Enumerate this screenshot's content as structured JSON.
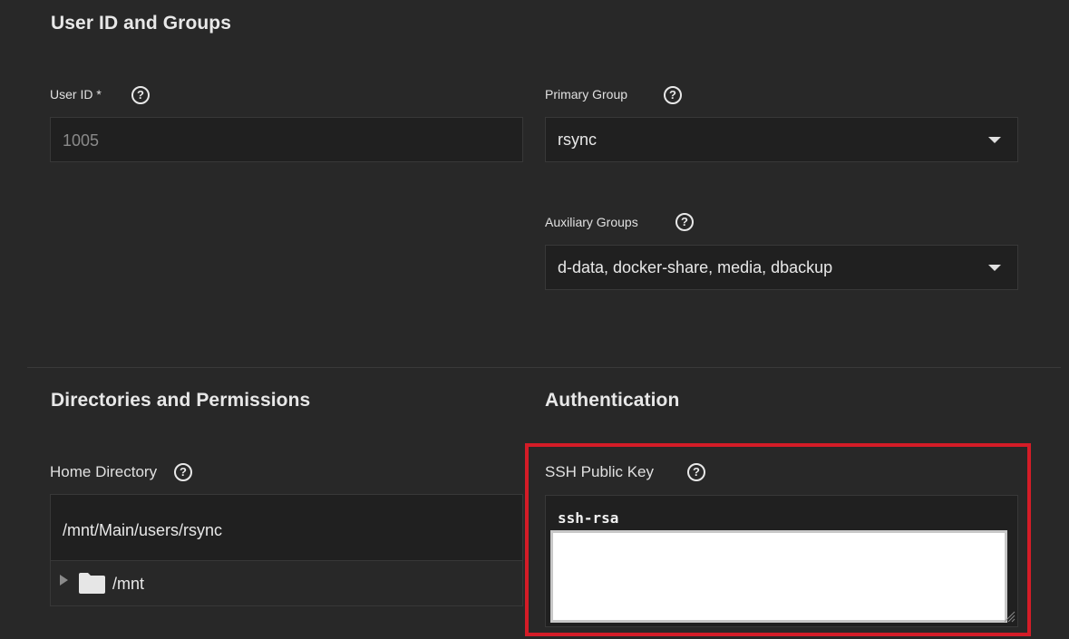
{
  "user_id_groups": {
    "title": "User ID and Groups",
    "user_id": {
      "label": "User ID *",
      "value": "1005",
      "help_icon": "help-circle-icon"
    },
    "primary_group": {
      "label": "Primary Group",
      "value": "rsync",
      "help_icon": "help-circle-icon"
    },
    "auxiliary_groups": {
      "label": "Auxiliary Groups",
      "value": "d-data, docker-share, media, dbackup",
      "help_icon": "help-circle-icon"
    }
  },
  "directories": {
    "title": "Directories and Permissions",
    "home_directory": {
      "label": "Home Directory",
      "value": "/mnt/Main/users/rsync",
      "help_icon": "help-circle-icon",
      "tree": [
        {
          "label": "/mnt",
          "icon": "folder-icon",
          "expanded": false
        }
      ]
    }
  },
  "authentication": {
    "title": "Authentication",
    "ssh_public_key": {
      "label": "SSH Public Key",
      "value": "ssh-rsa",
      "help_icon": "help-circle-icon"
    }
  },
  "colors": {
    "background": "#282828",
    "input_background": "#202020",
    "highlight": "#d41c27"
  }
}
